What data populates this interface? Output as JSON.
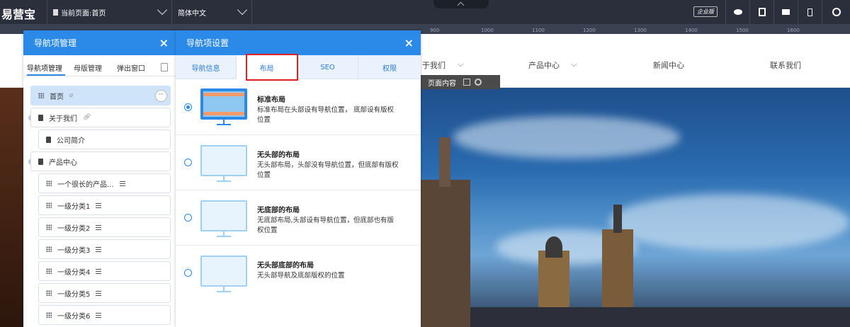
{
  "topbar": {
    "logo": "易营宝",
    "page_select": "当前页面:首页",
    "lang_select": "简体中文",
    "enterprise_badge": "企业版"
  },
  "ruler": {
    "ticks": [
      "900",
      "1000",
      "1100",
      "1200",
      "1300",
      "1400",
      "1500",
      "1600"
    ]
  },
  "site": {
    "nav": [
      "于我们",
      "产品中心",
      "新闻中心",
      "联系我们"
    ],
    "page_content_label": "页面内容"
  },
  "panel1": {
    "title": "导航项管理",
    "tabs": [
      "导航项管理",
      "母版管理",
      "弹出窗口"
    ],
    "tree": {
      "home": "首页",
      "about": "关于我们",
      "company": "公司简介",
      "products": "产品中心",
      "long_product": "一个很长的产品...",
      "cat1": "一级分类1",
      "cat2": "一级分类2",
      "cat3": "一级分类3",
      "cat4": "一级分类4",
      "cat5": "一级分类5",
      "cat6": "一级分类6"
    }
  },
  "panel2": {
    "title": "导航项设置",
    "tabs": [
      "导航信息",
      "布局",
      "SEO",
      "权限"
    ],
    "options": [
      {
        "title": "标准布局",
        "desc": "标准布局在头部设有导航位置， 底部设有版权位置",
        "selected": true
      },
      {
        "title": "无头部的布局",
        "desc": "无头部布局，头部没有导航位置，但底部有版权位置",
        "selected": false
      },
      {
        "title": "无底部的布局",
        "desc": "无底部布局,头部设有导航位置，但底部也有版权位置",
        "selected": false
      },
      {
        "title": "无头部底部的布局",
        "desc": "无头部导航及底部版权的位置",
        "selected": false
      }
    ]
  },
  "colors": {
    "accent": "#2b8ae8",
    "topbar": "#2a2f3b",
    "highlight": "#e02020"
  }
}
